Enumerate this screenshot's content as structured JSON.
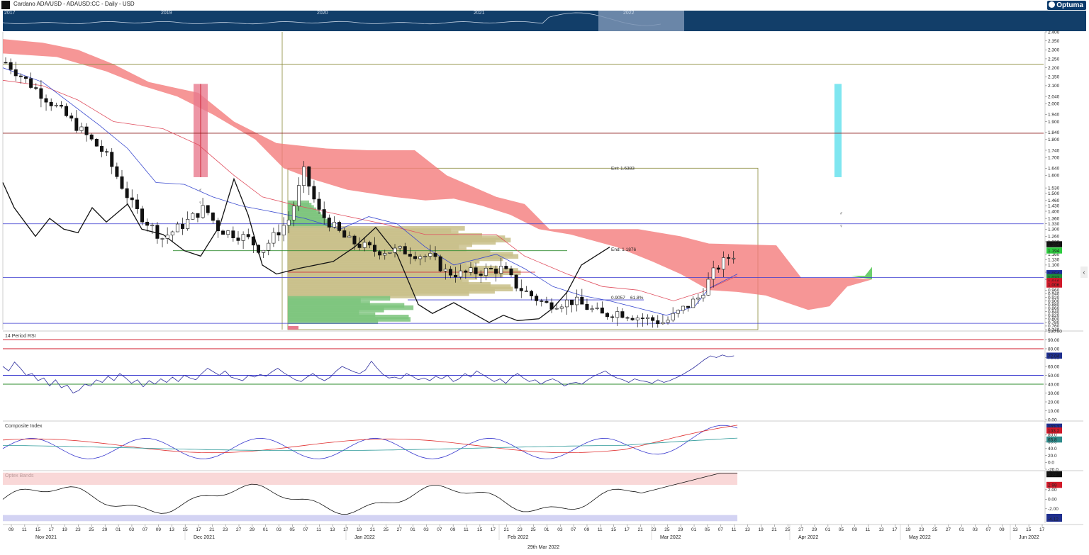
{
  "header": {
    "title": "Cardano ADA/USD - ADAUSD:CC - Daily - USD",
    "logo": "Optuma"
  },
  "navigator": {
    "years": [
      "2017",
      "2019",
      "2020",
      "2021",
      "2022"
    ]
  },
  "footer": {
    "date": "29th Mar 2022"
  },
  "colors": {
    "cloud": "#f47c7c",
    "rsi_line": "#2e2e9e",
    "red_level": "#d11a2a",
    "green_level": "#2e8b2e",
    "volume_tan": "#c9c08a",
    "volume_green": "#7cc47c",
    "nav_bg": "#123e69",
    "cyan_zone": "#7fe6f0",
    "pink_zone": "#e87a8e"
  },
  "chart_data": [
    {
      "type": "candlestick",
      "title": "Cardano ADA/USD - ADAUSD:CC - Daily - USD",
      "y_ticks": [
        "2.400",
        "2.350",
        "2.300",
        "2.250",
        "2.200",
        "2.150",
        "2.100",
        "2.040",
        "2.000",
        "1.940",
        "1.900",
        "1.840",
        "1.800",
        "1.740",
        "1.700",
        "1.640",
        "1.600",
        "1.530",
        "1.500",
        "1.460",
        "1.430",
        "1.400",
        "1.360",
        "1.330",
        "1.300",
        "1.260",
        "1.230",
        "1.160",
        "1.130",
        "1.100",
        "1.060",
        "1.020",
        "0.960",
        "0.940",
        "0.920",
        "0.900",
        "0.880",
        "0.860",
        "0.840",
        "0.820",
        "0.800",
        "0.780",
        "0.760",
        "0.740"
      ],
      "ylim": [
        0.74,
        2.4
      ],
      "price_labels": [
        {
          "text": "1.194",
          "bg": "#111111",
          "fg": "#ffffff",
          "value": 1.215
        },
        {
          "text": "1.194",
          "bg": "#2ecc40",
          "fg": "#111111",
          "value": 1.18
        },
        {
          "text": "1.054",
          "bg": "#1f2f9e",
          "fg": "#ffffff",
          "value": 1.054
        },
        {
          "text": "1.032",
          "bg": "#1f8f3a",
          "fg": "#ffffff",
          "value": 1.032
        },
        {
          "text": "1.010",
          "bg": "#d11a2a",
          "fg": "#ffffff",
          "value": 1.01
        },
        {
          "text": "1.006",
          "bg": "#d11a2a",
          "fg": "#ffffff",
          "value": 0.99
        }
      ],
      "annotations": [
        {
          "text": "Ext: 1.6383",
          "value": 1.6383
        },
        {
          "text": "End: 1.1876",
          "value": 1.1876
        },
        {
          "text": "0.9057",
          "value": 0.9057
        },
        {
          "text": "61.8%",
          "value": 0.9057
        }
      ],
      "horizontal_levels": [
        2.22,
        1.835,
        1.33,
        1.18,
        1.03,
        0.9057,
        0.775
      ]
    },
    {
      "type": "line",
      "title": "14 Period RSI",
      "y_ticks": [
        "100.00",
        "90.00",
        "80.00",
        "70.00",
        "60.00",
        "50.00",
        "40.00",
        "30.00",
        "20.00",
        "10.00",
        "0.00"
      ],
      "ylim": [
        0,
        100
      ],
      "levels": [
        90,
        80,
        50,
        40
      ],
      "value_label": {
        "text": "72.04",
        "value": 72.04
      },
      "series": [
        {
          "values": [
            60,
            55,
            65,
            58,
            50,
            52,
            44,
            47,
            38,
            45,
            36,
            39,
            30,
            33,
            40,
            38,
            45,
            42,
            49,
            44,
            52,
            47,
            41,
            45,
            37,
            44,
            40,
            46,
            42,
            48,
            43,
            50,
            47,
            45,
            52,
            58,
            54,
            50,
            55,
            48,
            46,
            44,
            50,
            48,
            51,
            49,
            54,
            58,
            53,
            49,
            45,
            43,
            48,
            52,
            47,
            44,
            48,
            55,
            60,
            57,
            54,
            52,
            56,
            66,
            58,
            51,
            47,
            48,
            46,
            52,
            49,
            45,
            47,
            44,
            49,
            46,
            50,
            43,
            46,
            52,
            48,
            55,
            51,
            47,
            43,
            46,
            41,
            48,
            52,
            47,
            43,
            45,
            40,
            44,
            46,
            43,
            38,
            41,
            42,
            40,
            45,
            49,
            52,
            55,
            50,
            47,
            45,
            42,
            46,
            44,
            43,
            41,
            45,
            42,
            44,
            47,
            50,
            54,
            58,
            63,
            68,
            72,
            70,
            73,
            71,
            72
          ]
        }
      ]
    },
    {
      "type": "line",
      "title": "Composite Index",
      "y_ticks": [
        "80.0",
        "60.0",
        "40.0",
        "20.0",
        "0.0",
        "-20.0"
      ],
      "ylim": [
        -20,
        120
      ],
      "value_labels": [
        {
          "text": "103.3",
          "value": 103.3
        },
        {
          "text": "103.2",
          "value": 92
        },
        {
          "text": "65.8",
          "value": 65.8
        }
      ]
    },
    {
      "type": "line",
      "title": "Optex Bands",
      "y_ticks": [
        "2.00",
        "0.00",
        "-2.00"
      ],
      "ylim": [
        -5,
        6
      ],
      "value_labels": [
        {
          "text": "5.22",
          "value": 5.22
        },
        {
          "text": "2.98",
          "value": 2.98
        },
        {
          "text": "-3.73",
          "value": -3.73
        },
        {
          "text": "-4.12",
          "value": -4.12
        }
      ]
    }
  ],
  "x_axis": {
    "day_ticks": [
      "09",
      "11",
      "15",
      "17",
      "19",
      "23",
      "25",
      "29",
      "01",
      "03",
      "07",
      "09",
      "13",
      "15",
      "17",
      "21",
      "23",
      "27",
      "29",
      "01",
      "03",
      "05",
      "07",
      "11",
      "13",
      "17",
      "19",
      "21",
      "25",
      "27",
      "01",
      "03",
      "07",
      "09",
      "11",
      "15",
      "17",
      "21",
      "23",
      "25",
      "01",
      "03",
      "07",
      "09",
      "11",
      "15",
      "17",
      "21",
      "23",
      "25",
      "29",
      "01",
      "05",
      "07",
      "11",
      "13",
      "19",
      "21",
      "25",
      "27",
      "29",
      "01",
      "05",
      "09",
      "11",
      "13",
      "17",
      "19",
      "23",
      "25",
      "27",
      "01",
      "03",
      "07",
      "09",
      "13",
      "15",
      "17"
    ],
    "months": [
      "Nov 2021",
      "Dec 2021",
      "Jan 2022",
      "Feb 2022",
      "Mar 2022",
      "Apr 2022",
      "May 2022",
      "Jun 2022"
    ]
  }
}
